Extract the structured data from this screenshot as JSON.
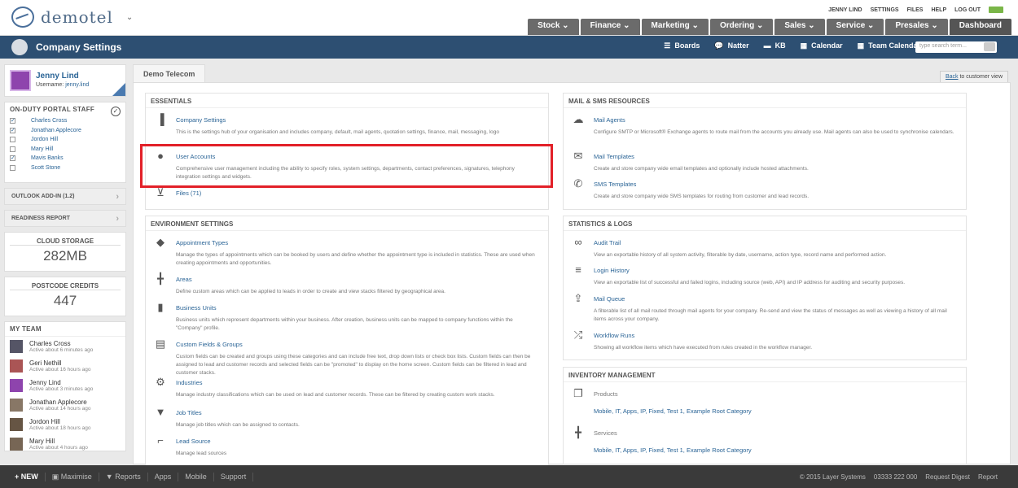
{
  "app": {
    "name": "demotel",
    "top_links": [
      "JENNY LIND",
      "SETTINGS",
      "FILES",
      "HELP",
      "LOG OUT"
    ],
    "main_menu": [
      "Stock",
      "Finance",
      "Marketing",
      "Ordering",
      "Sales",
      "Service",
      "Presales",
      "Dashboard"
    ]
  },
  "header": {
    "title": "Company Settings",
    "subnav": [
      "Boards",
      "Natter",
      "KB",
      "Calendar",
      "Team Calendar"
    ],
    "search_placeholder": "type search term..."
  },
  "profile": {
    "name": "Jenny Lind",
    "username_label": "Username:",
    "username": "jenny.lind"
  },
  "staff": {
    "title": "ON-DUTY PORTAL STAFF",
    "items": [
      {
        "name": "Charles Cross",
        "checked": true
      },
      {
        "name": "Jonathan Applecore",
        "checked": true
      },
      {
        "name": "Jordon Hill",
        "checked": false
      },
      {
        "name": "Mary Hill",
        "checked": false
      },
      {
        "name": "Mavis Banks",
        "checked": true
      },
      {
        "name": "Scott Stone",
        "checked": false
      }
    ]
  },
  "outlook": "OUTLOOK ADD-IN (1.2)",
  "readiness": "READINESS REPORT",
  "cloud": {
    "label": "CLOUD STORAGE",
    "value": "282MB"
  },
  "postcode": {
    "label": "POSTCODE CREDITS",
    "value": "447"
  },
  "team": {
    "title": "MY TEAM",
    "members": [
      {
        "name": "Charles Cross",
        "active": "Active about 6 minutes ago"
      },
      {
        "name": "Geri Nethill",
        "active": "Active about 16 hours ago"
      },
      {
        "name": "Jenny Lind",
        "active": "Active about 3 minutes ago"
      },
      {
        "name": "Jonathan Applecore",
        "active": "Active about 14 hours ago"
      },
      {
        "name": "Jordon Hill",
        "active": "Active about 18 hours ago"
      },
      {
        "name": "Mary Hill",
        "active": "Active about 4 hours ago"
      }
    ]
  },
  "tab": "Demo Telecom",
  "back_prefix": "Back",
  "back_suffix": " to customer view",
  "essentials": {
    "title": "ESSENTIALS",
    "items": [
      {
        "link": "Company Settings",
        "desc": "This is the settings hub of your organisation and includes company, default, mail agents, quotation settings, finance, mail, messaging, logo",
        "icon": "bar-chart"
      },
      {
        "link": "User Accounts",
        "desc": "Comprehensive user management including the ability to specify roles, system settings, departments, contact preferences, signatures, telephony integration settings and widgets.",
        "icon": "user"
      },
      {
        "link": "Files (71)",
        "desc": "",
        "icon": "inbox"
      }
    ]
  },
  "mail": {
    "title": "MAIL & SMS RESOURCES",
    "items": [
      {
        "link": "Mail Agents",
        "desc": "Configure SMTP or Microsoft® Exchange agents to route mail from the accounts you already use. Mail agents can also be used to synchronise calendars.",
        "icon": "cloud"
      },
      {
        "link": "Mail Templates",
        "desc": "Create and store company wide email templates and optionally include hosted attachments.",
        "icon": "envelope"
      },
      {
        "link": "SMS Templates",
        "desc": "Create and store company wide SMS templates for routing from customer and lead records.",
        "icon": "phone"
      }
    ]
  },
  "environment": {
    "title": "ENVIRONMENT SETTINGS",
    "items": [
      {
        "link": "Appointment Types",
        "desc": "Manage the types of appointments which can be booked by users and define whether the appointment type is included in statistics. These are used when creating appointments and opportunities.",
        "icon": "tag"
      },
      {
        "link": "Areas",
        "desc": "Define custom areas which can be applied to leads in order to create and view stacks filtered by geographical area.",
        "icon": "signpost"
      },
      {
        "link": "Business Units",
        "desc": "Business units which represent departments within your business. After creation, business units can be mapped to company functions within the \"Company\" profile.",
        "icon": "building"
      },
      {
        "link": "Custom Fields & Groups",
        "desc": "Custom fields can be created and groups using these categories and can include free text, drop down lists or check box lists. Custom fields can then be assigned to lead and customer records and selected fields can be \"promoted\" to display on the home screen. Custom fields can be filtered in lead and customer stacks.",
        "icon": "keyboard"
      },
      {
        "link": "Industries",
        "desc": "Manage industry classifications which can be used on lead and customer records. These can be filtered by creating custom work stacks.",
        "icon": "gear"
      },
      {
        "link": "Job Titles",
        "desc": "Manage job titles which can be assigned to contacts.",
        "icon": "tie"
      },
      {
        "link": "Lead Source",
        "desc": "Manage lead sources",
        "icon": "telescope"
      }
    ]
  },
  "stats": {
    "title": "STATISTICS & LOGS",
    "items": [
      {
        "link": "Audit Trail",
        "desc": "View an exportable history of all system activity, filterable by date, username, action type, record name and performed action.",
        "icon": "link"
      },
      {
        "link": "Login History",
        "desc": "View an exportable list of successful and failed logins, including source (web, API) and IP address for auditing and security purposes.",
        "icon": "list"
      },
      {
        "link": "Mail Queue",
        "desc": "A filterable list of all mail routed through mail agents for your company. Re-send and view the status of messages as well as viewing a history of all mail items across your company.",
        "icon": "upload"
      },
      {
        "link": "Workflow Runs",
        "desc": "Showing all workflow items which have executed from rules created in the workflow manager.",
        "icon": "shuffle"
      }
    ]
  },
  "inventory": {
    "title": "INVENTORY MANAGEMENT",
    "items": [
      {
        "label": "Products",
        "links": "Mobile, IT, Apps, IP, Fixed, Test 1, Example Root Category",
        "icon": "copy"
      },
      {
        "label": "Services",
        "links": "Mobile, IT, Apps, IP, Fixed, Test 1, Example Root Category",
        "icon": "signpost"
      }
    ]
  },
  "footer": {
    "left": [
      "NEW",
      "Maximise",
      "Reports",
      "Apps",
      "Mobile",
      "Support"
    ],
    "right": [
      "© 2015 Layer Systems",
      "03333 222 000",
      "Request Digest",
      "Report"
    ]
  }
}
